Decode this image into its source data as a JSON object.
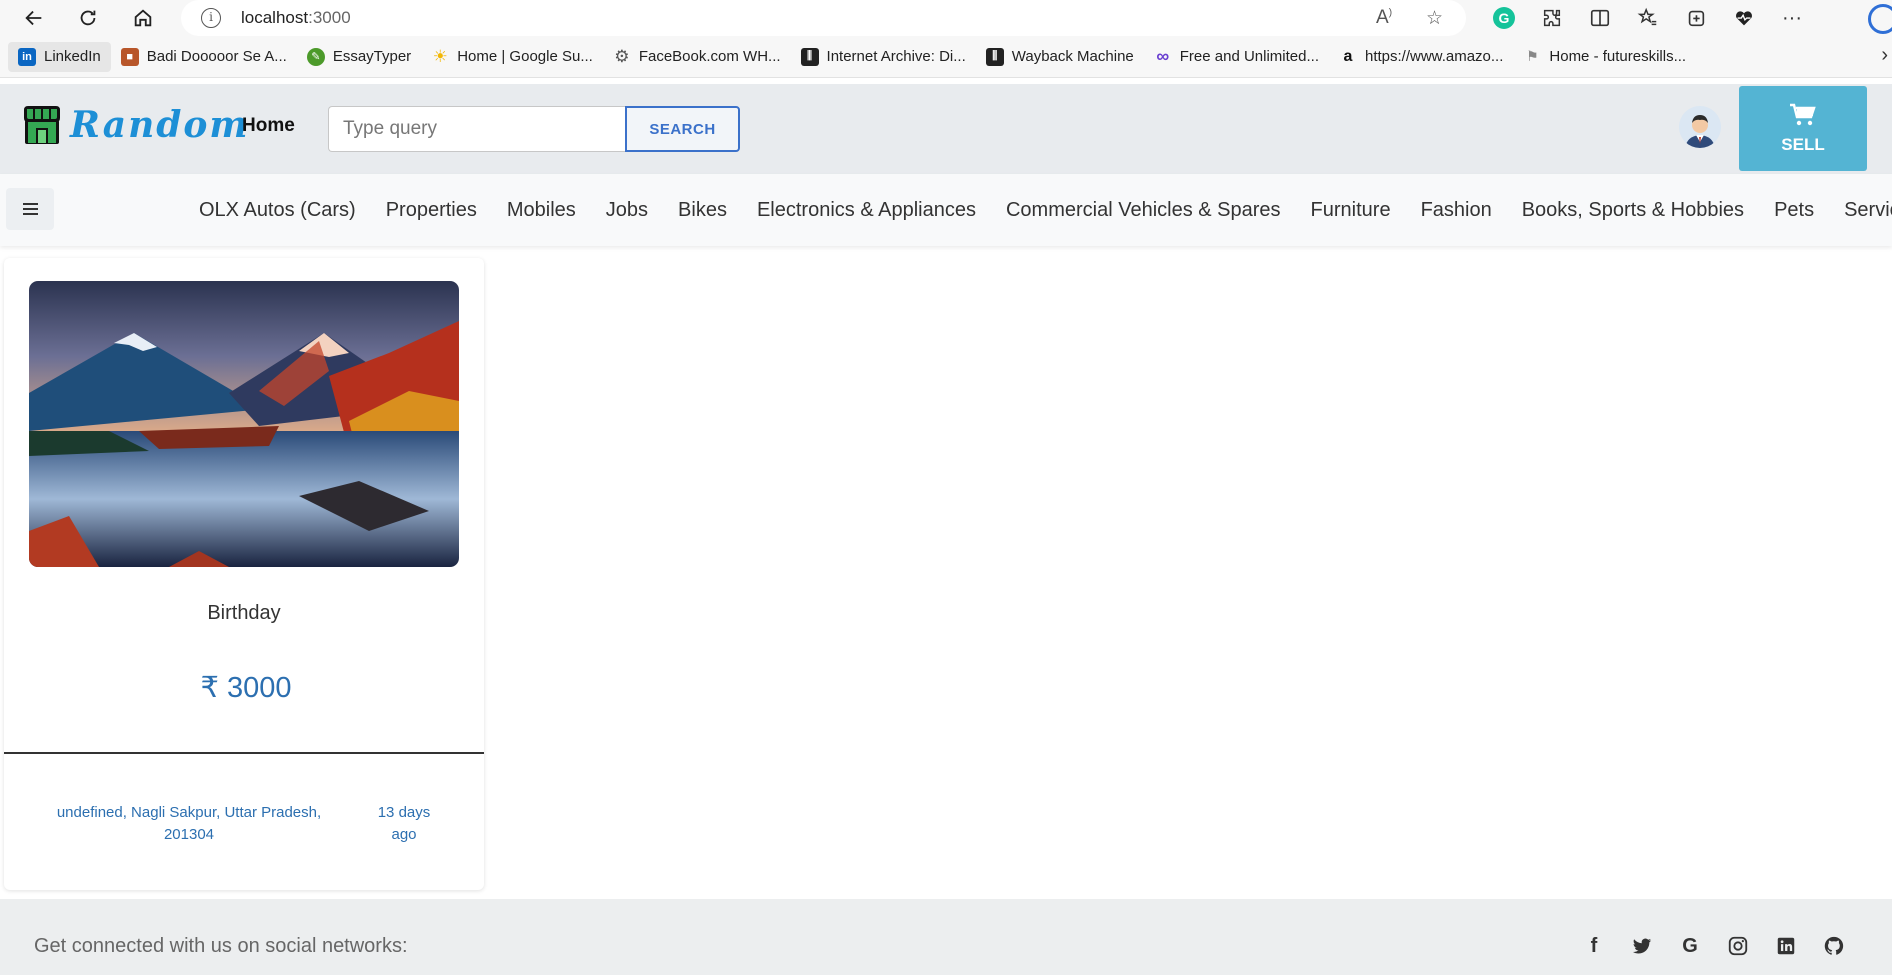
{
  "browser": {
    "url_host": "localhost",
    "url_port": ":3000",
    "bookmarks": [
      {
        "label": "LinkedIn",
        "icon": "linkedin-icon"
      },
      {
        "label": "Badi Dooooor Se A...",
        "icon": "bookmark-favicon"
      },
      {
        "label": "EssayTyper",
        "icon": "essaytyper-icon"
      },
      {
        "label": "Home | Google Su...",
        "icon": "sun-icon"
      },
      {
        "label": "FaceBook.com WH...",
        "icon": "gear-icon"
      },
      {
        "label": "Internet Archive: Di...",
        "icon": "archive-icon"
      },
      {
        "label": "Wayback Machine",
        "icon": "archive-icon"
      },
      {
        "label": "Free and Unlimited...",
        "icon": "infinity-icon"
      },
      {
        "label": "https://www.amazo...",
        "icon": "amazon-icon"
      },
      {
        "label": "Home - futureskills...",
        "icon": "futureskills-icon"
      }
    ]
  },
  "header": {
    "logo_text": "Random",
    "home_label": "Home",
    "search_placeholder": "Type query",
    "search_button": "SEARCH",
    "sell_label": "SELL"
  },
  "categories": [
    "OLX Autos (Cars)",
    "Properties",
    "Mobiles",
    "Jobs",
    "Bikes",
    "Electronics & Appliances",
    "Commercial Vehicles & Spares",
    "Furniture",
    "Fashion",
    "Books, Sports & Hobbies",
    "Pets",
    "Services"
  ],
  "product": {
    "title": "Birthday",
    "price": "₹ 3000",
    "location": "undefined, Nagli Sakpur, Uttar Pradesh, 201304",
    "time_ago": "13 days ago"
  },
  "footer": {
    "text": "Get connected with us on social networks:",
    "socials": [
      "facebook-icon",
      "twitter-icon",
      "google-icon",
      "instagram-icon",
      "linkedin-icon",
      "github-icon"
    ]
  },
  "colors": {
    "brand": "#1d8fd6",
    "sell_button": "#54b4d3",
    "search_accent": "#3b71ca",
    "price_text": "#2c6fb0"
  }
}
